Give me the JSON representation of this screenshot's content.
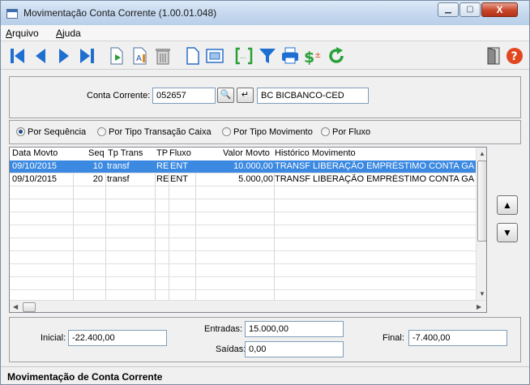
{
  "window": {
    "title": "Movimentação Conta Corrente (1.00.01.048)",
    "min_label": "▁",
    "max_label": "▢",
    "close_label": "X"
  },
  "menu": {
    "arquivo": {
      "first": "A",
      "rest": "rquivo"
    },
    "ajuda": {
      "first": "A",
      "rest": "juda"
    }
  },
  "toolbar": [
    "first-icon",
    "prev-icon",
    "next-icon",
    "last-icon",
    "new-icon",
    "edit-icon",
    "delete-icon",
    "document-icon",
    "preview-icon",
    "range-icon",
    "filter-icon",
    "print-icon",
    "currency-icon",
    "refresh-icon",
    "exit-icon",
    "help-icon"
  ],
  "account": {
    "label": "Conta Corrente:",
    "value": "052657",
    "search_glyph": "🔍",
    "enter_glyph": "↵",
    "name": "BC BICBANCO-CED"
  },
  "order_options": [
    {
      "label": "Por Sequência",
      "selected": true
    },
    {
      "label": "Por Tipo Transação Caixa",
      "selected": false
    },
    {
      "label": "Por Tipo Movimento",
      "selected": false
    },
    {
      "label": "Por Fluxo",
      "selected": false
    }
  ],
  "grid": {
    "headers": {
      "date": "Data Movto",
      "seq": "Seq",
      "tptrans": "Tp Trans",
      "tp": "TP",
      "fluxo": "Fluxo",
      "valor": "Valor Movto",
      "hist": "Histórico Movimento"
    },
    "rows": [
      {
        "date": "09/10/2015",
        "seq": "10",
        "tptrans": "transf",
        "tp": "RE",
        "fluxo": "ENT",
        "valor": "10.000,00",
        "hist": "TRANSF LIBERAÇÃO EMPRÉSTIMO CONTA GA",
        "selected": true
      },
      {
        "date": "09/10/2015",
        "seq": "20",
        "tptrans": "transf",
        "tp": "RE",
        "fluxo": "ENT",
        "valor": "5.000,00",
        "hist": "TRANSF LIBERAÇÃO EMPRÉSTIMO CONTA GA",
        "selected": false
      }
    ]
  },
  "nav": {
    "up": "▲",
    "down": "▼"
  },
  "totals": {
    "inicial_label": "Inicial:",
    "inicial": "-22.400,00",
    "entradas_label": "Entradas:",
    "entradas": "15.000,00",
    "saidas_label": "Saídas:",
    "saidas": "0,00",
    "final_label": "Final:",
    "final": "-7.400,00"
  },
  "status": "Movimentação de Conta Corrente"
}
